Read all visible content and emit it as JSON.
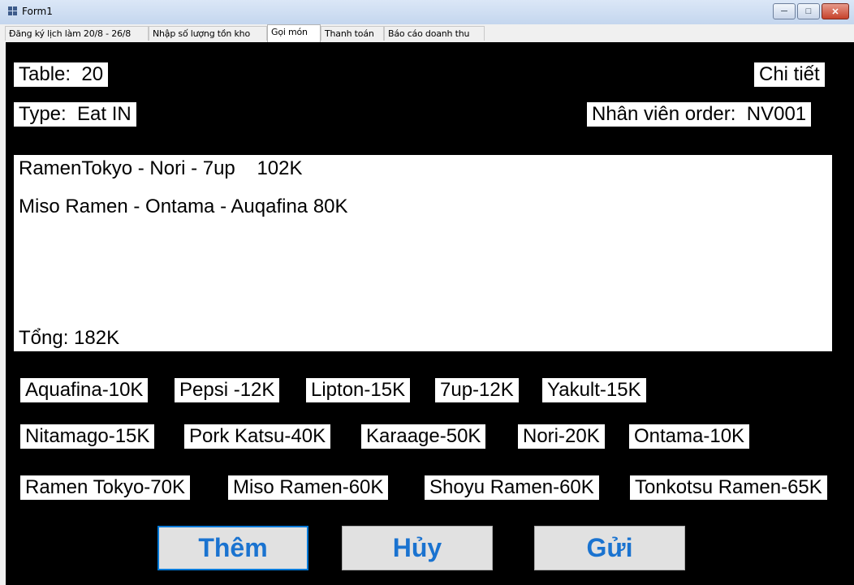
{
  "window": {
    "title": "Form1",
    "min_icon": "minimize-icon",
    "max_icon": "maximize-icon",
    "close_icon": "close-icon"
  },
  "tabs": [
    "Đăng ký lịch làm 20/8 - 26/8",
    "Nhập số lượng tồn kho",
    "Gọi món",
    "Thanh toán",
    "Báo cáo doanh thu"
  ],
  "active_tab": "Gọi món",
  "order": {
    "table": "Table:  20",
    "type": "Type:  Eat IN",
    "detail_label": "Chi tiết",
    "staff": "Nhân viên order:  NV001",
    "lines": [
      "RamenTokyo - Nori - 7up    102K",
      "Miso Ramen - Ontama - Auqafina 80K"
    ],
    "total": "Tổng: 182K"
  },
  "menu": {
    "drinks": [
      "Aquafina-10K",
      "Pepsi -12K",
      "Lipton-15K",
      "7up-12K",
      "Yakult-15K"
    ],
    "toppings": [
      "Nitamago-15K",
      "Pork Katsu-40K",
      "Karaage-50K",
      "Nori-20K",
      "Ontama-10K"
    ],
    "ramen": [
      "Ramen Tokyo-70K",
      "Miso Ramen-60K",
      "Shoyu Ramen-60K",
      "Tonkotsu Ramen-65K"
    ]
  },
  "actions": {
    "add": "Thêm",
    "cancel": "Hủy",
    "send": "Gửi"
  },
  "colors": {
    "panel": "#000000",
    "button_text": "#1a73d0",
    "titlebar": "#c4d6ee"
  }
}
